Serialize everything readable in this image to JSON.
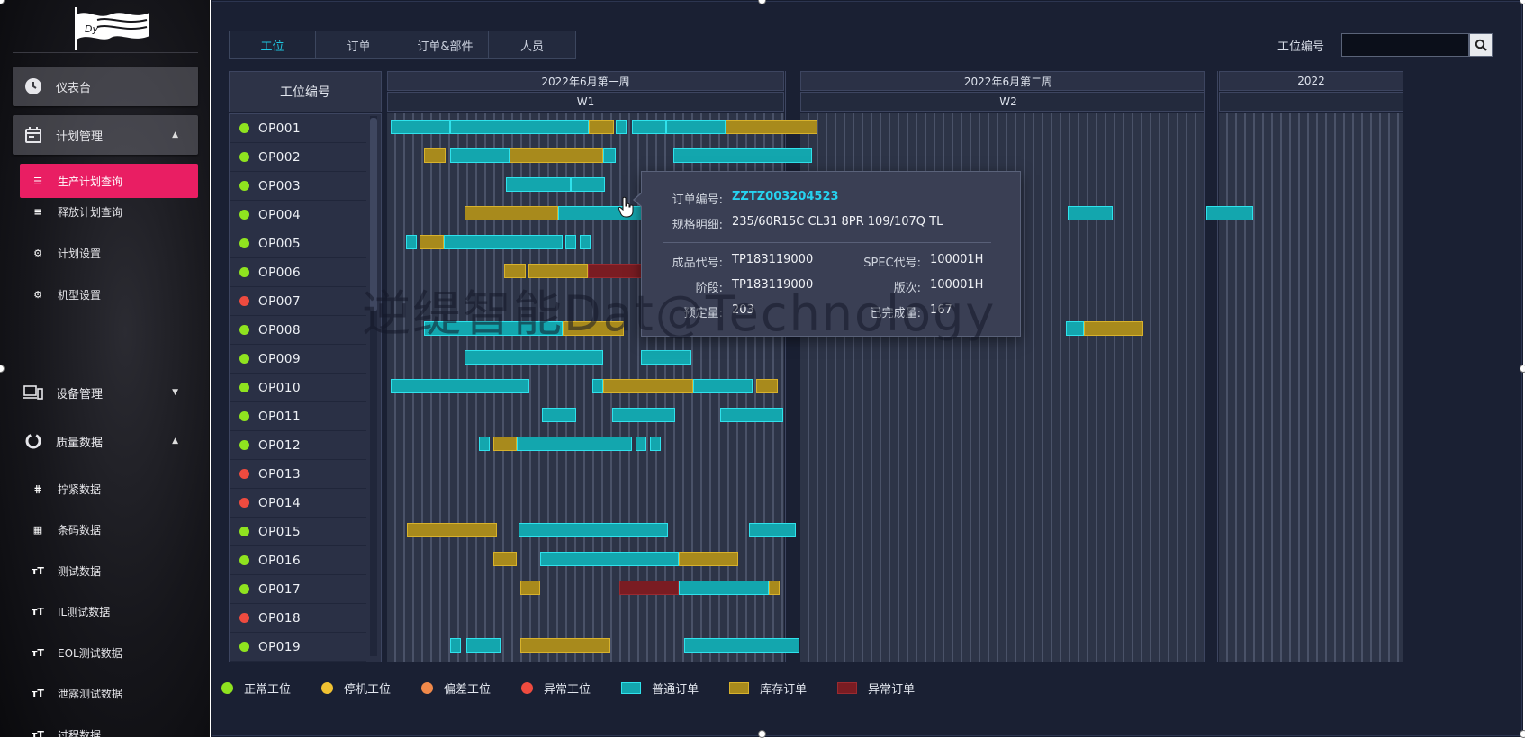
{
  "sidebar": {
    "menu": [
      {
        "label": "仪表台",
        "icon": "clock-icon",
        "boxed": true
      },
      {
        "label": "计划管理",
        "icon": "calendar-icon",
        "boxed": true,
        "expanded": true
      },
      {
        "label": "设备管理",
        "icon": "devices-icon",
        "expanded": false
      },
      {
        "label": "质量数据",
        "icon": "donut-chart-icon",
        "expanded": true
      }
    ],
    "plan_sub": [
      {
        "label": "生产计划查询",
        "icon": "list-icon",
        "active": true
      },
      {
        "label": "释放计划查询",
        "icon": "list-check-icon"
      },
      {
        "label": "计划设置",
        "icon": "gear-icon"
      },
      {
        "label": "机型设置",
        "icon": "gear-icon"
      }
    ],
    "quality_sub": [
      {
        "label": "拧紧数据",
        "icon": "tighten-icon"
      },
      {
        "label": "条码数据",
        "icon": "barcode-icon"
      },
      {
        "label": "测试数据",
        "icon": "text-size-icon"
      },
      {
        "label": "IL测试数据",
        "icon": "text-size-icon"
      },
      {
        "label": "EOL测试数据",
        "icon": "text-size-icon"
      },
      {
        "label": "泄露测试数据",
        "icon": "text-size-icon"
      },
      {
        "label": "过程数据",
        "icon": "text-size-icon"
      }
    ]
  },
  "tabs": [
    {
      "label": "工位",
      "active": true
    },
    {
      "label": "订单"
    },
    {
      "label": "订单&部件"
    },
    {
      "label": "人员"
    }
  ],
  "search": {
    "label": "工位编号",
    "value": ""
  },
  "station_header": "工位编号",
  "station_colors": {
    "normal": "#8fe31f",
    "stopped": "#f1c232",
    "deviation": "#f0894a",
    "abnormal": "#ee4b3f"
  },
  "stations": [
    {
      "name": "OP001",
      "status": "normal"
    },
    {
      "name": "OP002",
      "status": "normal"
    },
    {
      "name": "OP003",
      "status": "normal"
    },
    {
      "name": "OP004",
      "status": "normal"
    },
    {
      "name": "OP005",
      "status": "normal"
    },
    {
      "name": "OP006",
      "status": "normal"
    },
    {
      "name": "OP007",
      "status": "abnormal"
    },
    {
      "name": "OP008",
      "status": "normal"
    },
    {
      "name": "OP009",
      "status": "normal"
    },
    {
      "name": "OP010",
      "status": "normal"
    },
    {
      "name": "OP011",
      "status": "normal"
    },
    {
      "name": "OP012",
      "status": "normal"
    },
    {
      "name": "OP013",
      "status": "abnormal"
    },
    {
      "name": "OP014",
      "status": "abnormal"
    },
    {
      "name": "OP015",
      "status": "normal"
    },
    {
      "name": "OP016",
      "status": "normal"
    },
    {
      "name": "OP017",
      "status": "normal"
    },
    {
      "name": "OP018",
      "status": "abnormal"
    },
    {
      "name": "OP019",
      "status": "normal"
    }
  ],
  "weeks": [
    {
      "title": "2022年6月第一周",
      "sub": "W1"
    },
    {
      "title": "2022年6月第二周",
      "sub": "W2"
    },
    {
      "title": "2022",
      "sub": ""
    }
  ],
  "tooltip": {
    "order_no_label": "订单编号:",
    "order_no": "ZZTZ003204523",
    "spec_label": "规格明细:",
    "spec": "235/60R15C CL31 8PR 109/107Q TL",
    "product_code_label": "成品代号:",
    "product_code": "TP183119000",
    "spec_code_label": "SPEC代号:",
    "spec_code": "100001H",
    "stage_label": "阶段:",
    "stage": "TP183119000",
    "version_label": "版次:",
    "version": "100001H",
    "planned_label": "预定量:",
    "planned": "203",
    "completed_label": "已完成量:",
    "completed": "167"
  },
  "watermark": "逆缇智能Dat@Technology",
  "legend": [
    {
      "label": "正常工位",
      "kind": "dot",
      "color": "#8fe31f"
    },
    {
      "label": "停机工位",
      "kind": "dot",
      "color": "#f1c232"
    },
    {
      "label": "偏差工位",
      "kind": "dot",
      "color": "#f0894a"
    },
    {
      "label": "异常工位",
      "kind": "dot",
      "color": "#ee4b3f"
    },
    {
      "label": "普通订单",
      "kind": "box",
      "color": "#13a6ae"
    },
    {
      "label": "库存订单",
      "kind": "box",
      "color": "#a88a1c"
    },
    {
      "label": "异常订单",
      "kind": "box",
      "color": "#7a1c22"
    }
  ]
}
